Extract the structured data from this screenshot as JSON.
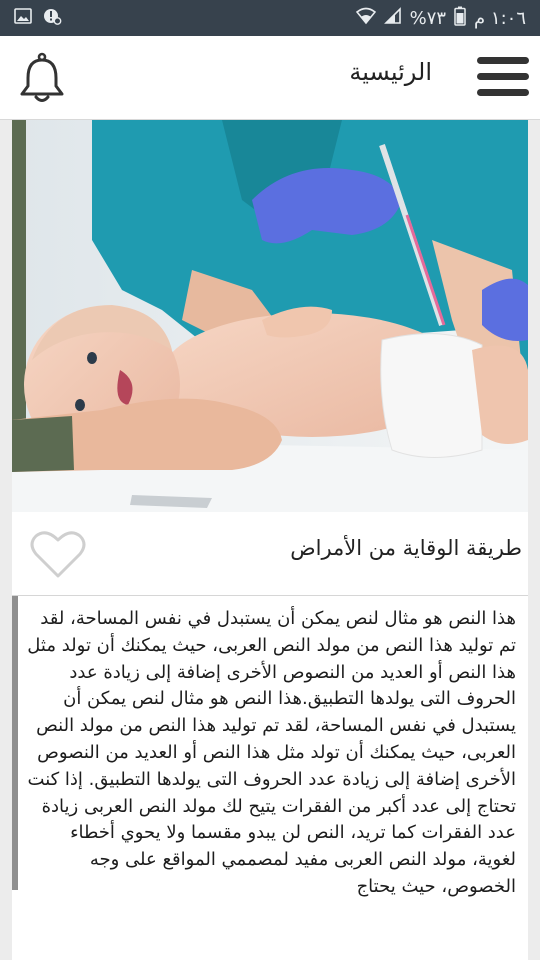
{
  "status_bar": {
    "time": "١:٠٦ م",
    "battery": "%٧٣",
    "icons": [
      "battery-icon",
      "signal-icon",
      "wifi-icon",
      "alert-icon",
      "image-icon"
    ]
  },
  "app_bar": {
    "title": "الرئيسية",
    "icons": [
      "bell-icon",
      "hamburger-menu-icon"
    ]
  },
  "article": {
    "title": "طريقة الوقاية من الأمراض",
    "favorite_icon": "heart-outline-icon",
    "image_icon": "hero-photo",
    "body": "هذا النص هو مثال لنص يمكن أن يستبدل في نفس المساحة، لقد تم توليد هذا النص من مولد النص العربى، حيث يمكنك أن تولد مثل هذا النص أو العديد من النصوص الأخرى إضافة إلى زيادة عدد الحروف التى يولدها التطبيق.هذا النص هو مثال لنص يمكن أن يستبدل في نفس المساحة، لقد تم توليد هذا النص من مولد النص العربى، حيث يمكنك أن تولد مثل هذا النص أو العديد من النصوص الأخرى إضافة إلى زيادة عدد الحروف التى يولدها التطبيق. إذا كنت تحتاج إلى عدد أكبر من الفقرات يتيح لك مولد النص العربى زيادة عدد الفقرات كما تريد، النص لن يبدو مقسما ولا يحوي أخطاء لغوية، مولد النص العربى مفيد لمصممي المواقع على وجه الخصوص، حيث يحتاج"
  },
  "colors": {
    "status_bar": "#37424d",
    "app_bar": "#ffffff",
    "page_background": "#ececec",
    "scrubs": "#1f9bb0",
    "gloves": "#5b6fe0"
  }
}
